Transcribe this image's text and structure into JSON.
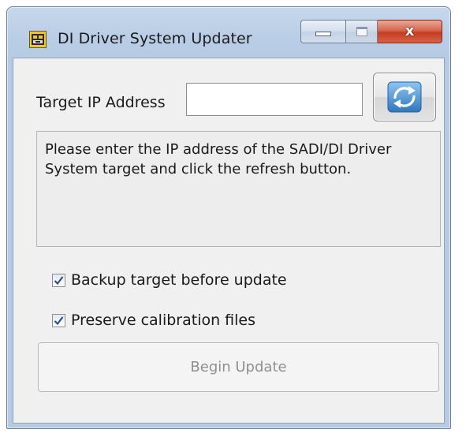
{
  "window": {
    "title": "DI Driver System Updater",
    "app_icon": "labview-app-icon",
    "caption_buttons": {
      "minimize_icon": "minimize-icon",
      "maximize_icon": "maximize-icon",
      "close_icon": "close-icon",
      "close_glyph": "x"
    }
  },
  "form": {
    "ip_label": "Target IP Address",
    "ip_value": "",
    "refresh_icon": "refresh-icon",
    "message": "Please enter the IP address of the SADI/DI Driver System target and click the refresh button.",
    "options": [
      {
        "label": "Backup target before update",
        "checked": true
      },
      {
        "label": "Preserve calibration files",
        "checked": true
      }
    ],
    "begin_button": "Begin Update",
    "begin_enabled": false
  },
  "colors": {
    "refresh_arrows": "#3f86c9",
    "checkmark": "#2a4f8a",
    "close_button": "#c73d20",
    "disabled_text": "#8f8f8f"
  }
}
